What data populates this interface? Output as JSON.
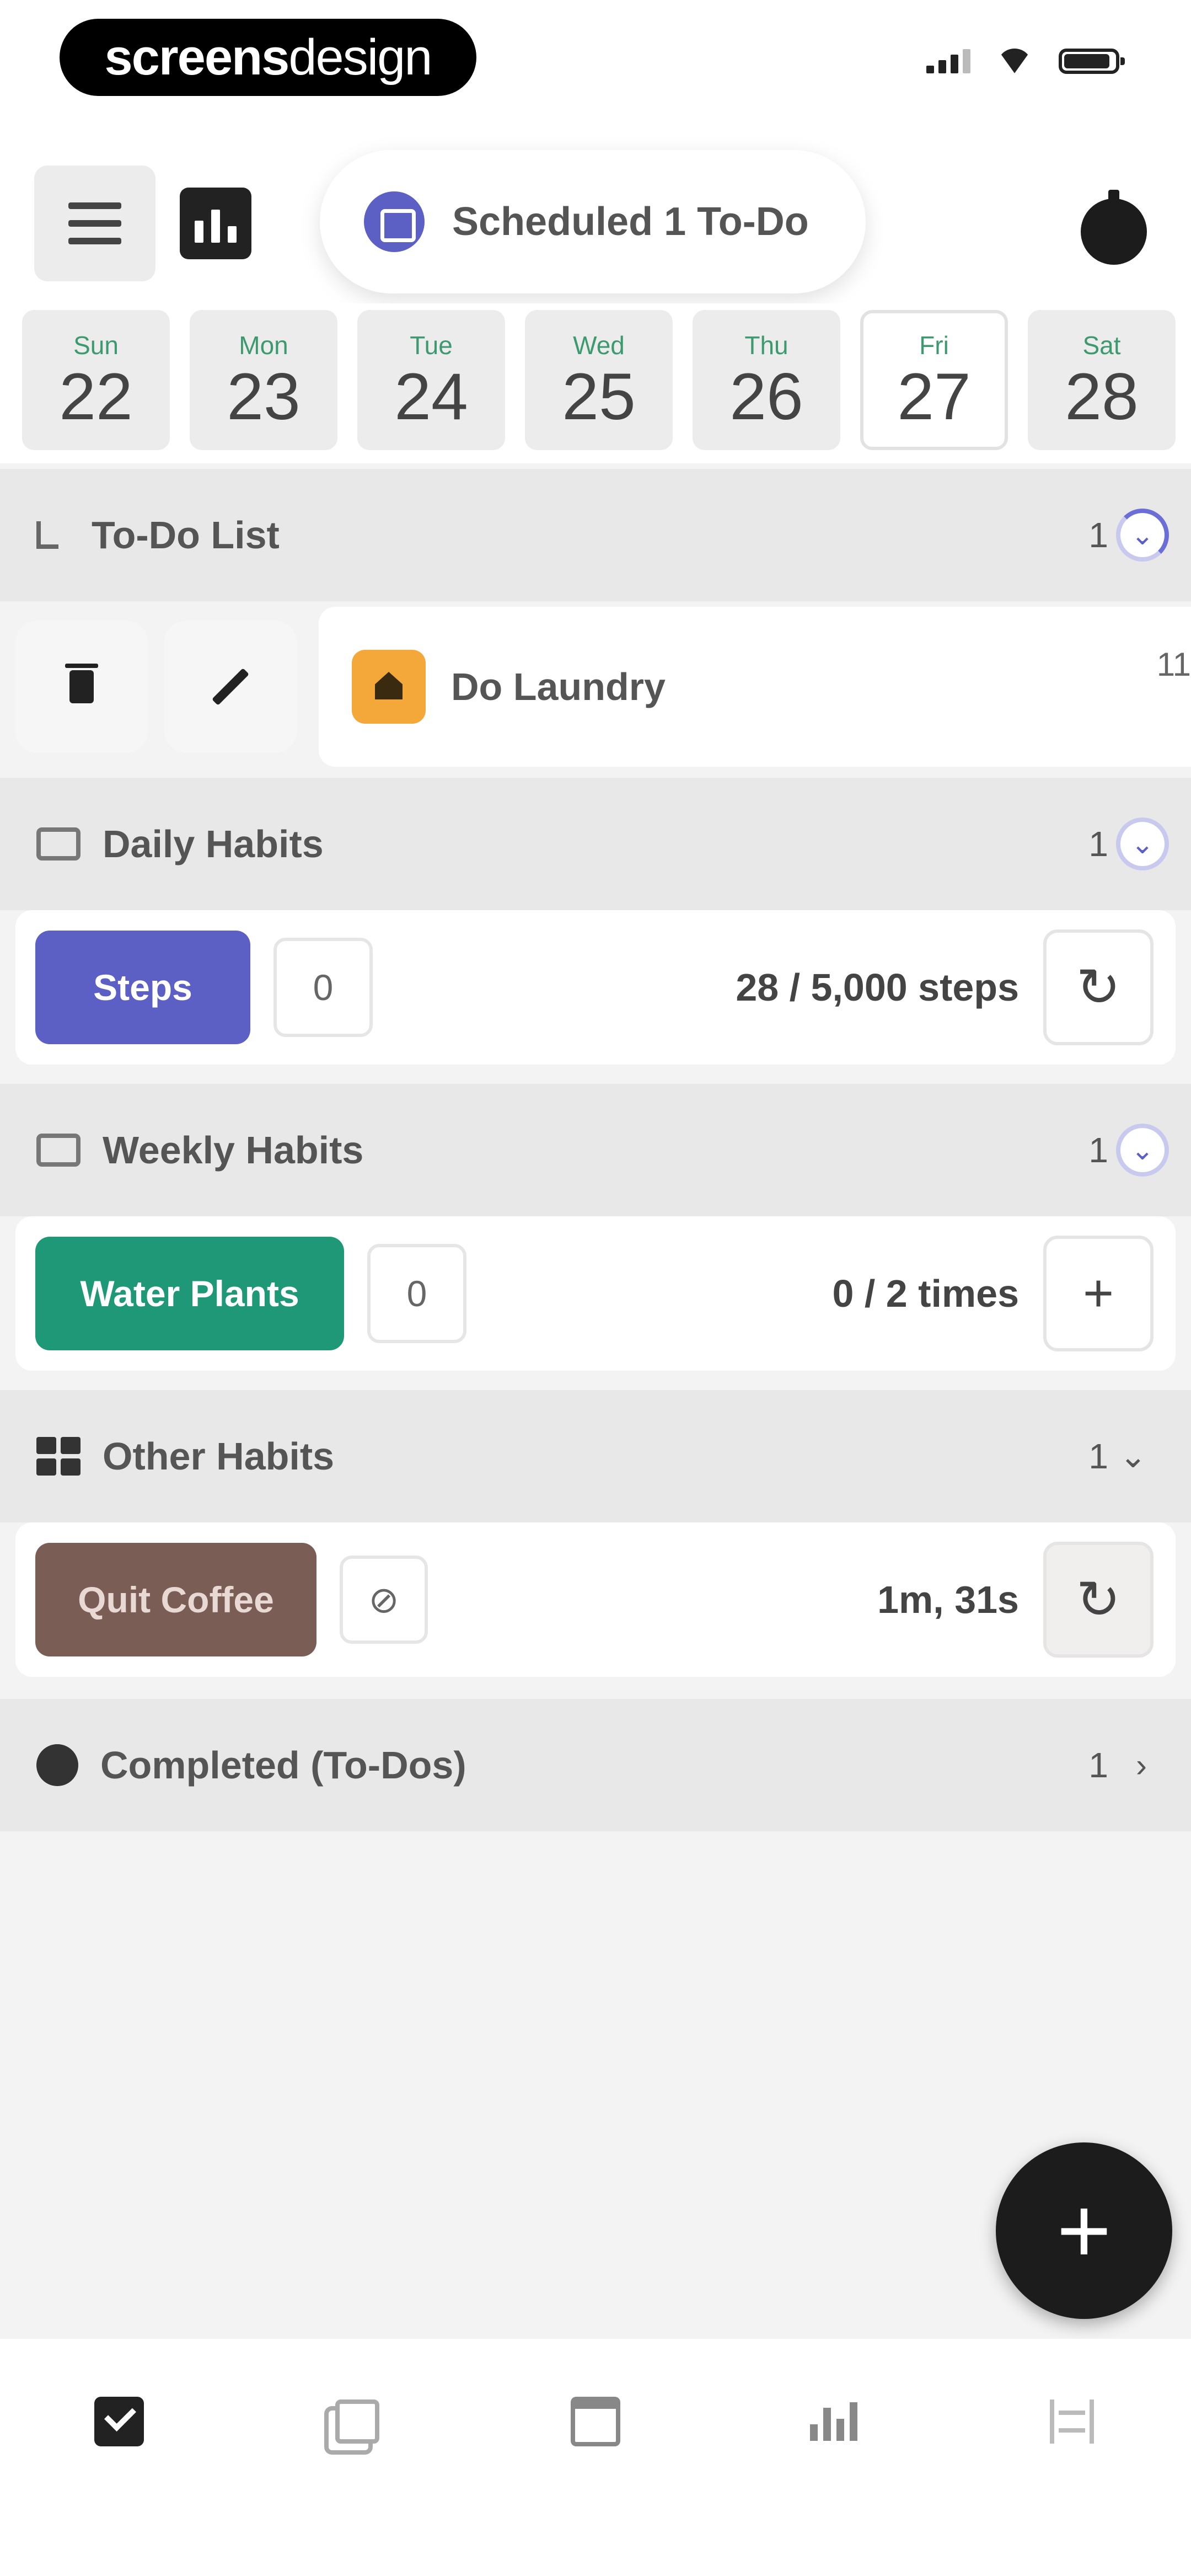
{
  "brand": {
    "bold": "screens",
    "light": "design"
  },
  "header": {
    "notification": "Scheduled 1 To-Do"
  },
  "days": [
    {
      "name": "Sun",
      "num": "22"
    },
    {
      "name": "Mon",
      "num": "23"
    },
    {
      "name": "Tue",
      "num": "24"
    },
    {
      "name": "Wed",
      "num": "25"
    },
    {
      "name": "Thu",
      "num": "26"
    },
    {
      "name": "Fri",
      "num": "27",
      "selected": true
    },
    {
      "name": "Sat",
      "num": "28"
    }
  ],
  "todo": {
    "title": "To-Do List",
    "count": "1",
    "item": "Do Laundry",
    "item_cut": "11"
  },
  "daily": {
    "title": "Daily Habits",
    "count": "1",
    "chip": "Steps",
    "streak": "0",
    "progress": "28 / 5,000 steps"
  },
  "weekly": {
    "title": "Weekly Habits",
    "count": "1",
    "chip": "Water Plants",
    "streak": "0",
    "progress": "0 / 2 times"
  },
  "other": {
    "title": "Other Habits",
    "count": "1",
    "chip": "Quit Coffee",
    "progress": "1m, 31s"
  },
  "completed": {
    "title": "Completed (To-Dos)",
    "count": "1"
  },
  "colors": {
    "accent": "#5c5fc4",
    "steps": "#5c5fc4",
    "water": "#1f9877",
    "coffee": "#7a5d55",
    "laundry": "#f4a83a"
  },
  "icons": {
    "daily_toggle": "⌄",
    "reset": "↻",
    "add": "+",
    "fab": "+"
  }
}
